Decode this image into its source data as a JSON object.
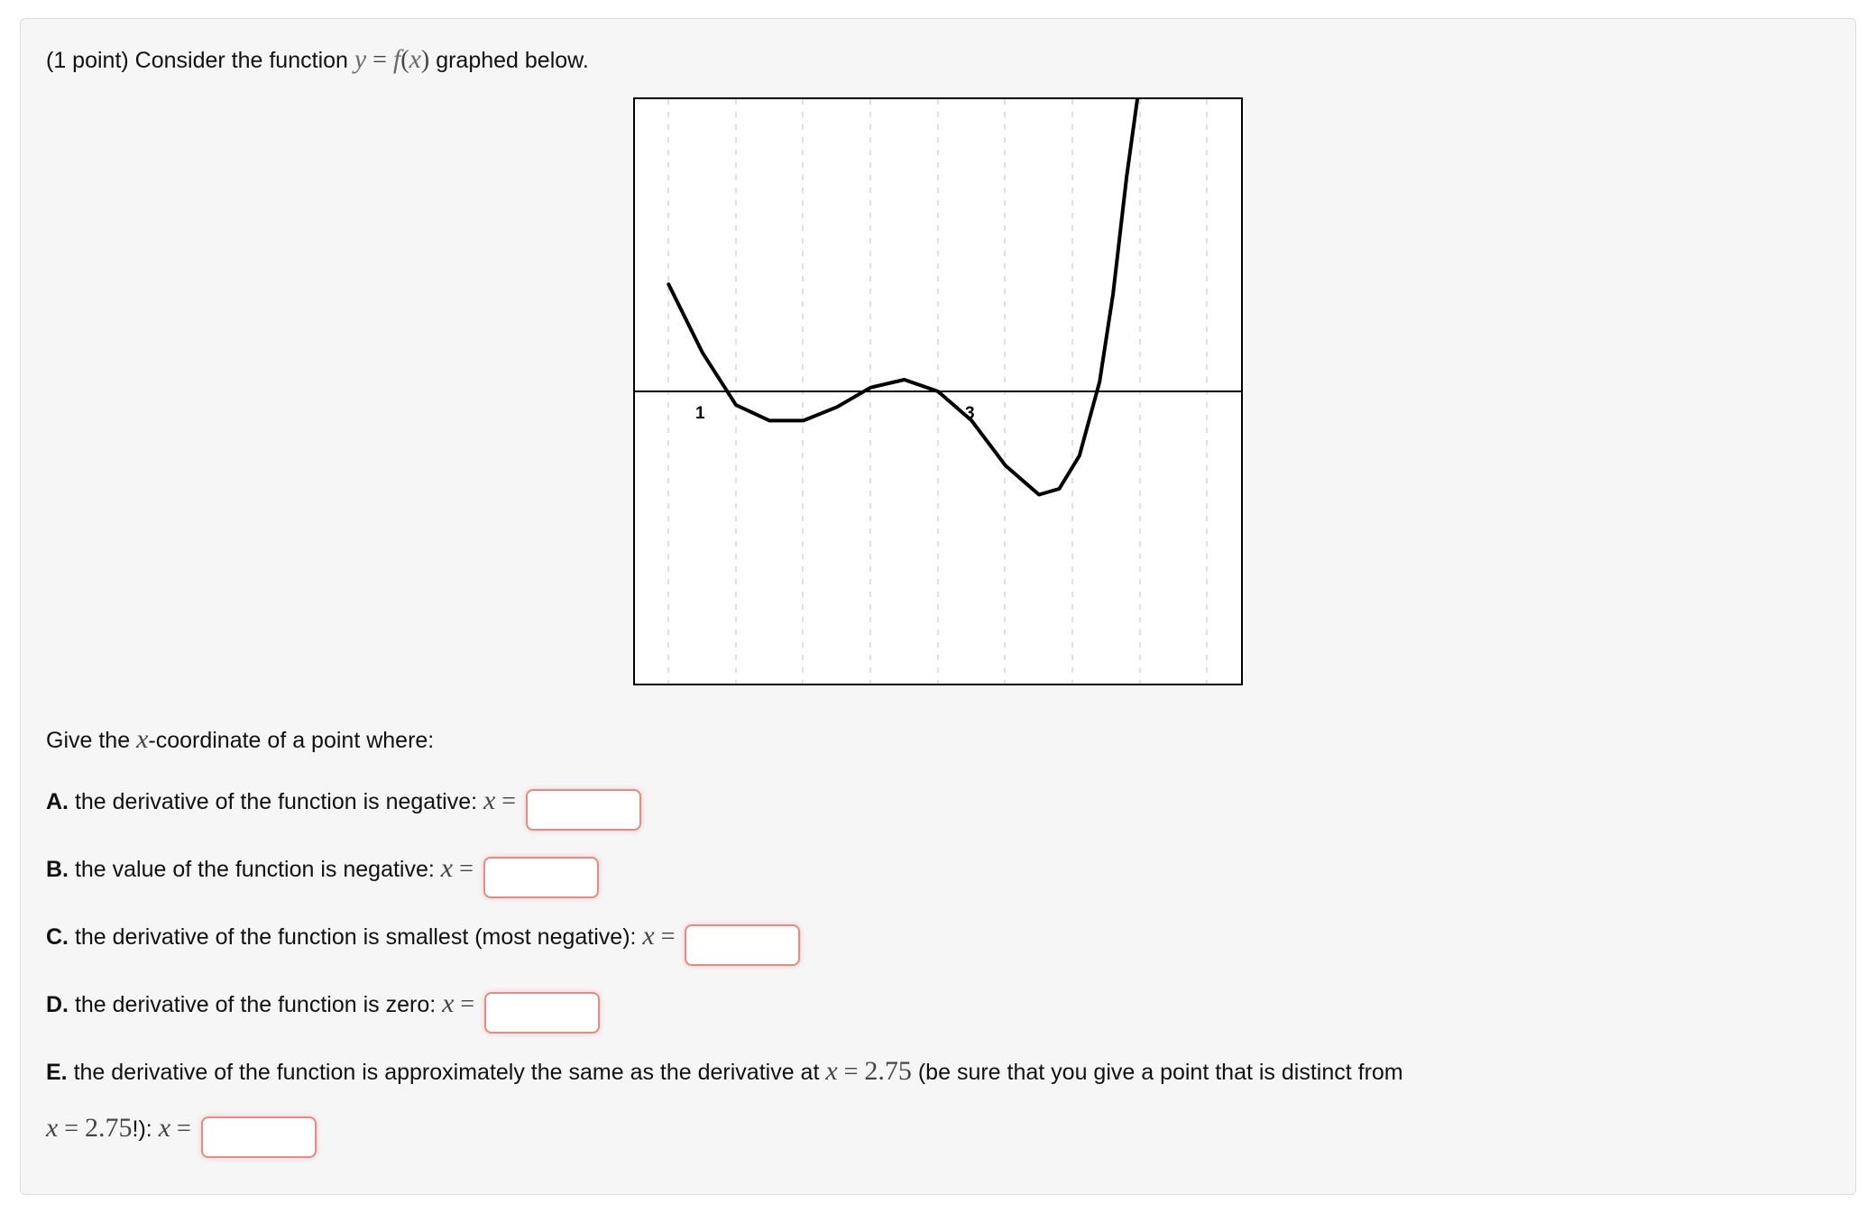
{
  "prompt": {
    "points": "(1 point)",
    "pre": "Consider the function ",
    "eq_lhs": "y",
    "eq_op": "=",
    "eq_f": "f",
    "eq_arg_open": "(",
    "eq_arg": "x",
    "eq_arg_close": ")",
    "post": " graphed below."
  },
  "lead": {
    "pre": "Give the ",
    "var": "x",
    "post": "-coordinate of a point where:"
  },
  "q": {
    "A": {
      "label": "A.",
      "text": "the derivative of the function is negative:",
      "var": "x",
      "op": "="
    },
    "B": {
      "label": "B.",
      "text": "the value of the function is negative:",
      "var": "x",
      "op": "="
    },
    "C": {
      "label": "C.",
      "text": "the derivative of the function is smallest (most negative):",
      "var": "x",
      "op": "="
    },
    "D": {
      "label": "D.",
      "text": "the derivative of the function is zero:",
      "var": "x",
      "op": "="
    },
    "E": {
      "label": "E.",
      "text": "the derivative of the function is approximately the same as the derivative at",
      "var": "x",
      "op": "=",
      "val": "2.75",
      "paren": "(be sure that you give a point that is distinct from",
      "var2": "x",
      "op2": "=",
      "val2": "2.75",
      "bang": "!):",
      "var3": "x",
      "op3": "="
    }
  },
  "ticks": {
    "t1": "1",
    "t3": "3"
  },
  "chart_data": {
    "type": "line",
    "title": "",
    "xlabel": "",
    "ylabel": "",
    "xlim": [
      0,
      4.5
    ],
    "ylim": [
      -1.5,
      1.5
    ],
    "x_ticks_shown": [
      1,
      3
    ],
    "series": [
      {
        "name": "f(x)",
        "points": [
          [
            0.25,
            0.55
          ],
          [
            0.5,
            0.2
          ],
          [
            0.75,
            -0.07
          ],
          [
            1.0,
            -0.15
          ],
          [
            1.25,
            -0.15
          ],
          [
            1.5,
            -0.08
          ],
          [
            1.75,
            0.02
          ],
          [
            2.0,
            0.06
          ],
          [
            2.25,
            0.0
          ],
          [
            2.5,
            -0.15
          ],
          [
            2.75,
            -0.38
          ],
          [
            3.0,
            -0.53
          ],
          [
            3.15,
            -0.5
          ],
          [
            3.3,
            -0.33
          ],
          [
            3.45,
            0.05
          ],
          [
            3.55,
            0.5
          ],
          [
            3.65,
            1.1
          ],
          [
            3.75,
            1.6
          ]
        ]
      }
    ]
  }
}
